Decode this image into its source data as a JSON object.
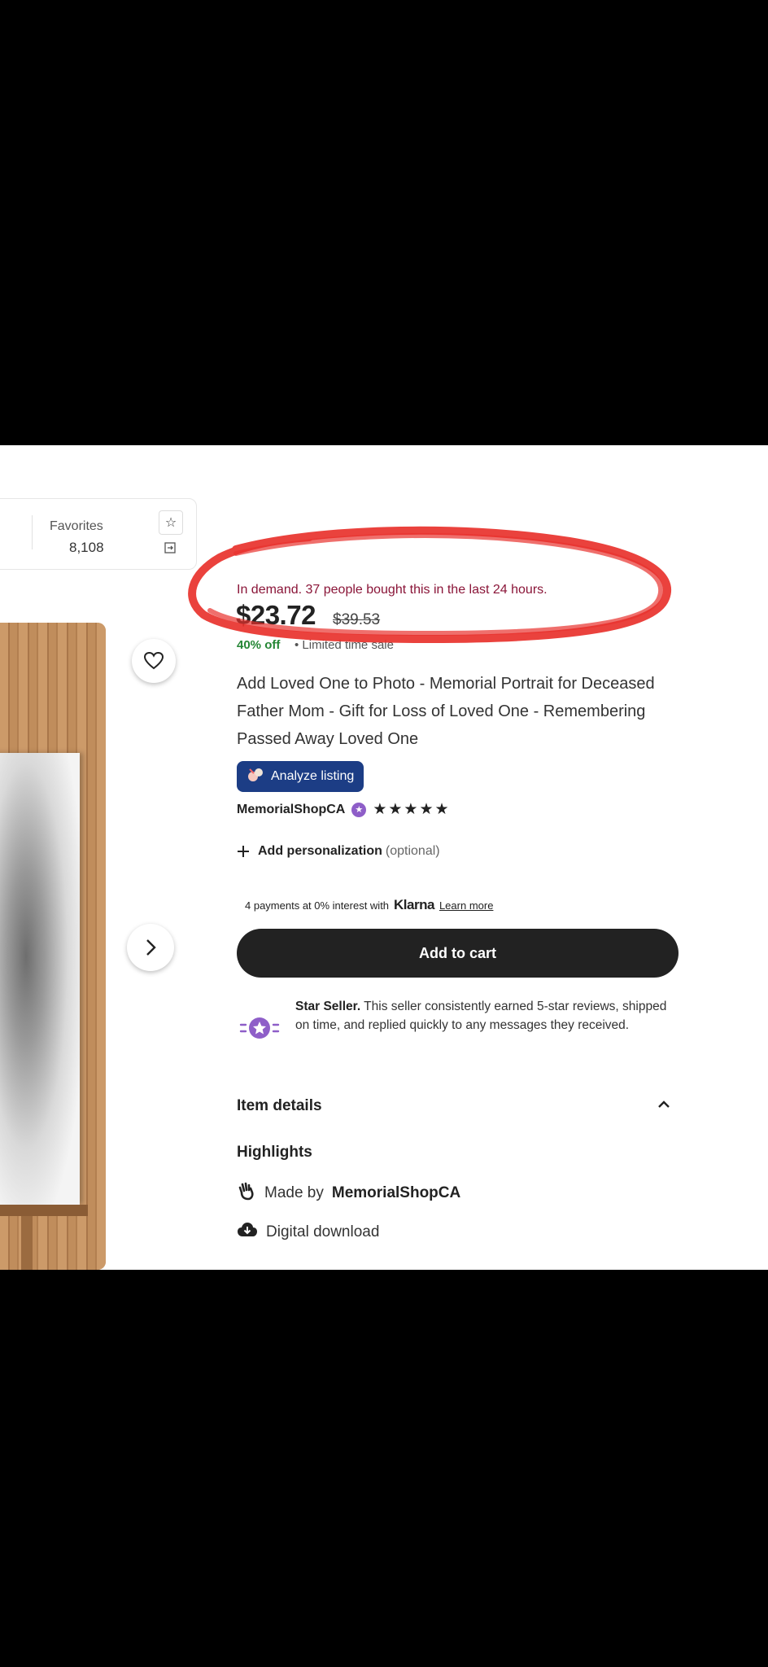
{
  "stats": {
    "favorites_label": "Favorites",
    "favorites_count": "8,108"
  },
  "product": {
    "demand_text": "In demand. 37 people bought this in the last 24 hours.",
    "price": "$23.72",
    "original_price": "$39.53",
    "discount": "40% off",
    "sale_suffix": "• Limited time sale",
    "title": "Add Loved One to Photo - Memorial Portrait for Deceased Father Mom - Gift for Loss of Loved One - Remembering Passed Away Loved One"
  },
  "analyze_button": {
    "label": "Analyze listing"
  },
  "shop": {
    "name": "MemorialShopCA",
    "stars": "★★★★★"
  },
  "personalization": {
    "label": "Add personalization",
    "optional": "(optional)"
  },
  "klarna": {
    "text": "4 payments at 0% interest with",
    "brand": "Klarna",
    "link": "Learn more"
  },
  "cart": {
    "label": "Add to cart"
  },
  "star_seller": {
    "title": "Star Seller.",
    "text": "This seller consistently earned 5-star reviews, shipped on time, and replied quickly to any messages they received."
  },
  "details": {
    "section_label": "Item details",
    "highlights_label": "Highlights",
    "made_by_prefix": "Made by",
    "made_by_shop": "MemorialShopCA",
    "digital": "Digital download"
  },
  "colors": {
    "demand": "#8a1538",
    "discount": "#258635",
    "analyze_bg": "#1c3d85",
    "cart_bg": "#222222",
    "annotation": "#e8322d"
  }
}
